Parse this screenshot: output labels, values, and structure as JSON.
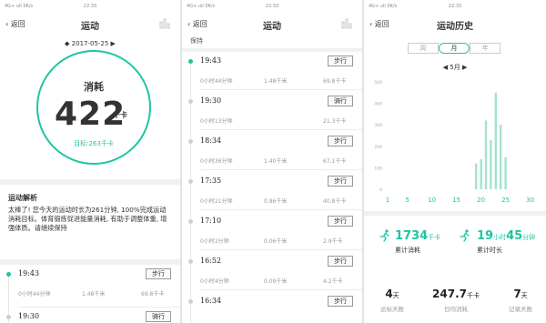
{
  "status": {
    "left": "4G+ ull 0K/s",
    "time": "22:33"
  },
  "panel1": {
    "back": "返回",
    "title": "运动",
    "date": "◆ 2017-05-25 ▶",
    "ring_label": "消耗",
    "calories": "422",
    "unit": "千卡",
    "goal": "目标:263千卡",
    "analysis_title": "运动解析",
    "analysis_text": "太棒了! 您今天的运动时长为261分钟, 100%完成运动消耗目标。体育锻炼促进能量消耗, 有助于调整体重, 增强体质。请继续保持",
    "entries": [
      {
        "time": "19:43",
        "button": "步行",
        "duration": "0小时44分钟",
        "distance": "1.48千米",
        "kcal": "69.8千卡"
      },
      {
        "time": "19:30",
        "button": "骑行",
        "duration": "",
        "distance": "",
        "kcal": ""
      }
    ]
  },
  "panel2": {
    "back": "返回",
    "title": "运动",
    "top_text": "保持",
    "entries": [
      {
        "time": "19:43",
        "button": "步行",
        "duration": "0小时44分钟",
        "distance": "1.48千米",
        "kcal": "69.8千卡"
      },
      {
        "time": "19:30",
        "button": "骑行",
        "duration": "0小时13分钟",
        "distance": "",
        "kcal": "21.3千卡"
      },
      {
        "time": "18:34",
        "button": "步行",
        "duration": "0小时36分钟",
        "distance": "1.40千米",
        "kcal": "67.1千卡"
      },
      {
        "time": "17:35",
        "button": "步行",
        "duration": "0小时21分钟",
        "distance": "0.86千米",
        "kcal": "40.8千卡"
      },
      {
        "time": "17:10",
        "button": "步行",
        "duration": "0小时2分钟",
        "distance": "0.06千米",
        "kcal": "2.9千卡"
      },
      {
        "time": "16:52",
        "button": "步行",
        "duration": "0小时4分钟",
        "distance": "0.09千米",
        "kcal": "4.2千卡"
      },
      {
        "time": "16:34",
        "button": "步行",
        "duration": "",
        "distance": "",
        "kcal": ""
      }
    ]
  },
  "panel3": {
    "back": "返回",
    "title": "运动历史",
    "tabs": [
      "周",
      "月",
      "年"
    ],
    "month": "◀ 5月 ▶",
    "stat1_value": "1734",
    "stat1_unit": "千卡",
    "stat1_label": "累计消耗",
    "stat2_value": "19",
    "stat2_unit1": "小时",
    "stat2_value2": "45",
    "stat2_unit2": "分钟",
    "stat2_label": "累计时长",
    "b1_value": "4",
    "b1_unit": "天",
    "b1_label": "达标天数",
    "b2_value": "247.7",
    "b2_unit": "千卡",
    "b2_label": "日均消耗",
    "b3_value": "7",
    "b3_unit": "天",
    "b3_label": "记录天数"
  },
  "chart_data": {
    "type": "bar",
    "x_ticks": [
      "1",
      "5",
      "10",
      "15",
      "20",
      "25",
      "30"
    ],
    "y_ticks": [
      "0",
      "100",
      "200",
      "300",
      "400",
      "500"
    ],
    "ylim": [
      0,
      500
    ],
    "xlim": [
      1,
      31
    ],
    "x": [
      19,
      20,
      21,
      22,
      23,
      24,
      25
    ],
    "values": [
      120,
      140,
      320,
      230,
      450,
      300,
      150
    ],
    "color": "#a6e3cf"
  },
  "accent": "#1fc4a4"
}
